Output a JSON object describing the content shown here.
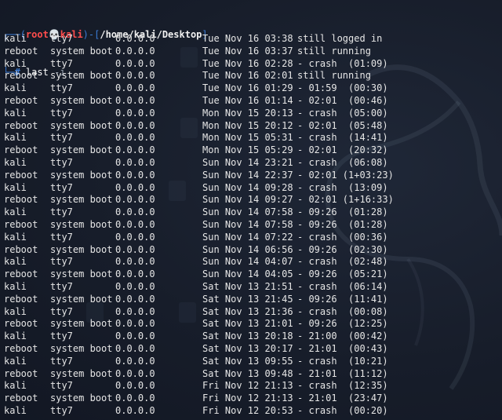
{
  "prompt": {
    "open_bracket": "┌──(",
    "user": "root",
    "skull": "💀",
    "host": "kali",
    "mid": ")-[",
    "path": "/home/kali/Desktop",
    "close_bracket": "]",
    "second_line_prefix": "└─",
    "hash": "#",
    "command": "last",
    "flag": "-i"
  },
  "rows": [
    {
      "user": "kali",
      "tty": "tty7",
      "ip": "0.0.0.0",
      "date": "Tue Nov 16 03:38",
      "rest": "still logged in"
    },
    {
      "user": "reboot",
      "tty": "system boot",
      "ip": "0.0.0.0",
      "date": "Tue Nov 16 03:37",
      "rest": "still running"
    },
    {
      "user": "kali",
      "tty": "tty7",
      "ip": "0.0.0.0",
      "date": "Tue Nov 16 02:28",
      "rest": "- crash  (01:09)"
    },
    {
      "user": "reboot",
      "tty": "system boot",
      "ip": "0.0.0.0",
      "date": "Tue Nov 16 02:01",
      "rest": "still running"
    },
    {
      "user": "kali",
      "tty": "tty7",
      "ip": "0.0.0.0",
      "date": "Tue Nov 16 01:29",
      "rest": "- 01:59  (00:30)"
    },
    {
      "user": "reboot",
      "tty": "system boot",
      "ip": "0.0.0.0",
      "date": "Tue Nov 16 01:14",
      "rest": "- 02:01  (00:46)"
    },
    {
      "user": "kali",
      "tty": "tty7",
      "ip": "0.0.0.0",
      "date": "Mon Nov 15 20:13",
      "rest": "- crash  (05:00)"
    },
    {
      "user": "reboot",
      "tty": "system boot",
      "ip": "0.0.0.0",
      "date": "Mon Nov 15 20:12",
      "rest": "- 02:01  (05:48)"
    },
    {
      "user": "kali",
      "tty": "tty7",
      "ip": "0.0.0.0",
      "date": "Mon Nov 15 05:31",
      "rest": "- crash  (14:41)"
    },
    {
      "user": "reboot",
      "tty": "system boot",
      "ip": "0.0.0.0",
      "date": "Mon Nov 15 05:29",
      "rest": "- 02:01  (20:32)"
    },
    {
      "user": "kali",
      "tty": "tty7",
      "ip": "0.0.0.0",
      "date": "Sun Nov 14 23:21",
      "rest": "- crash  (06:08)"
    },
    {
      "user": "reboot",
      "tty": "system boot",
      "ip": "0.0.0.0",
      "date": "Sun Nov 14 22:37",
      "rest": "- 02:01 (1+03:23)"
    },
    {
      "user": "kali",
      "tty": "tty7",
      "ip": "0.0.0.0",
      "date": "Sun Nov 14 09:28",
      "rest": "- crash  (13:09)"
    },
    {
      "user": "reboot",
      "tty": "system boot",
      "ip": "0.0.0.0",
      "date": "Sun Nov 14 09:27",
      "rest": "- 02:01 (1+16:33)"
    },
    {
      "user": "kali",
      "tty": "tty7",
      "ip": "0.0.0.0",
      "date": "Sun Nov 14 07:58",
      "rest": "- 09:26  (01:28)"
    },
    {
      "user": "reboot",
      "tty": "system boot",
      "ip": "0.0.0.0",
      "date": "Sun Nov 14 07:58",
      "rest": "- 09:26  (01:28)"
    },
    {
      "user": "kali",
      "tty": "tty7",
      "ip": "0.0.0.0",
      "date": "Sun Nov 14 07:22",
      "rest": "- crash  (00:36)"
    },
    {
      "user": "reboot",
      "tty": "system boot",
      "ip": "0.0.0.0",
      "date": "Sun Nov 14 06:56",
      "rest": "- 09:26  (02:30)"
    },
    {
      "user": "kali",
      "tty": "tty7",
      "ip": "0.0.0.0",
      "date": "Sun Nov 14 04:07",
      "rest": "- crash  (02:48)"
    },
    {
      "user": "reboot",
      "tty": "system boot",
      "ip": "0.0.0.0",
      "date": "Sun Nov 14 04:05",
      "rest": "- 09:26  (05:21)"
    },
    {
      "user": "kali",
      "tty": "tty7",
      "ip": "0.0.0.0",
      "date": "Sat Nov 13 21:51",
      "rest": "- crash  (06:14)"
    },
    {
      "user": "reboot",
      "tty": "system boot",
      "ip": "0.0.0.0",
      "date": "Sat Nov 13 21:45",
      "rest": "- 09:26  (11:41)"
    },
    {
      "user": "kali",
      "tty": "tty7",
      "ip": "0.0.0.0",
      "date": "Sat Nov 13 21:36",
      "rest": "- crash  (00:08)"
    },
    {
      "user": "reboot",
      "tty": "system boot",
      "ip": "0.0.0.0",
      "date": "Sat Nov 13 21:01",
      "rest": "- 09:26  (12:25)"
    },
    {
      "user": "kali",
      "tty": "tty7",
      "ip": "0.0.0.0",
      "date": "Sat Nov 13 20:18",
      "rest": "- 21:00  (00:42)"
    },
    {
      "user": "reboot",
      "tty": "system boot",
      "ip": "0.0.0.0",
      "date": "Sat Nov 13 20:17",
      "rest": "- 21:01  (00:43)"
    },
    {
      "user": "kali",
      "tty": "tty7",
      "ip": "0.0.0.0",
      "date": "Sat Nov 13 09:55",
      "rest": "- crash  (10:21)"
    },
    {
      "user": "reboot",
      "tty": "system boot",
      "ip": "0.0.0.0",
      "date": "Sat Nov 13 09:48",
      "rest": "- 21:01  (11:12)"
    },
    {
      "user": "kali",
      "tty": "tty7",
      "ip": "0.0.0.0",
      "date": "Fri Nov 12 21:13",
      "rest": "- crash  (12:35)"
    },
    {
      "user": "reboot",
      "tty": "system boot",
      "ip": "0.0.0.0",
      "date": "Fri Nov 12 21:13",
      "rest": "- 21:01  (23:47)"
    },
    {
      "user": "kali",
      "tty": "tty7",
      "ip": "0.0.0.0",
      "date": "Fri Nov 12 20:53",
      "rest": "- crash  (00:20)"
    }
  ]
}
